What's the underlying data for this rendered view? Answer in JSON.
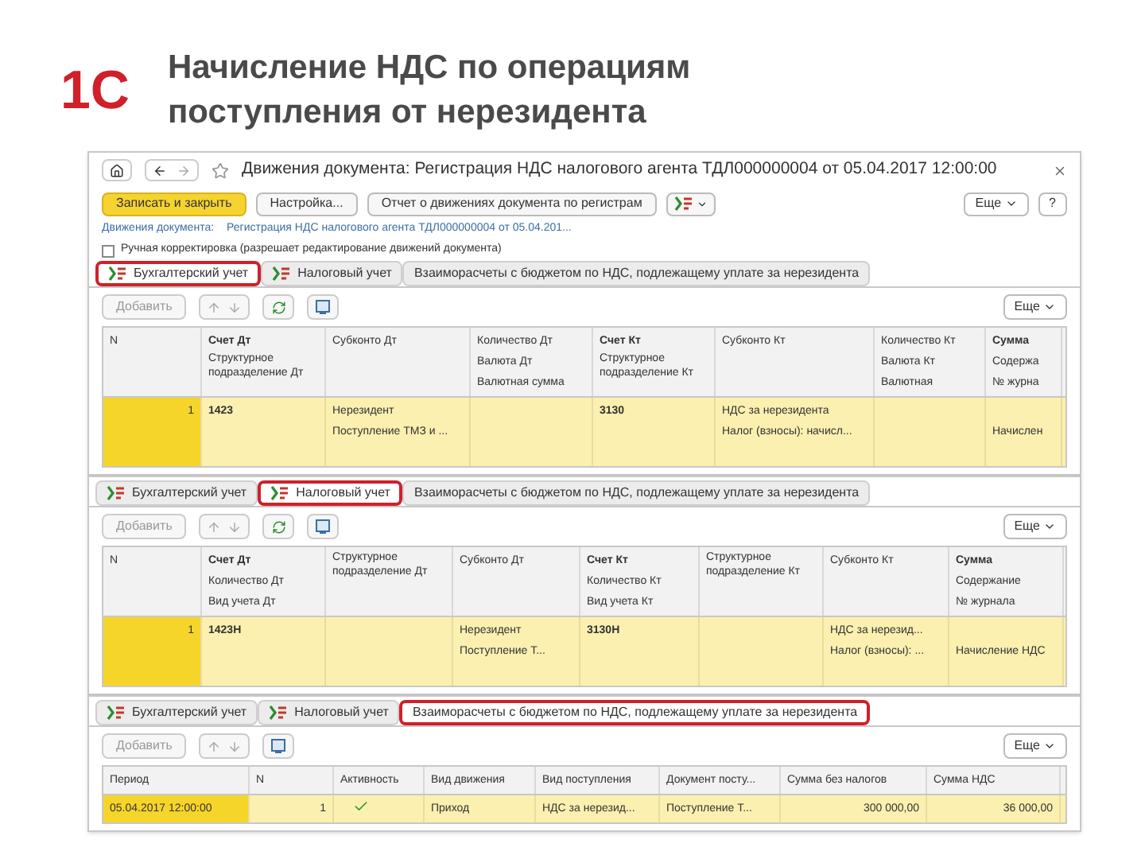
{
  "slide": {
    "logo": "1С",
    "title": "Начисление НДС по операциям поступления от нерезидента"
  },
  "main_window": {
    "title": "Движения документа: Регистрация НДС налогового агента ТДЛ000000004 от 05.04.2017 12:00:00",
    "buttons": [
      {
        "kind": "primary",
        "label": "Записать и закрыть"
      },
      {
        "kind": "plain",
        "label": "Настройка..."
      },
      {
        "kind": "plain",
        "label": "Отчет о движениях документа по регистрам"
      },
      {
        "kind": "dtkt_menu"
      }
    ],
    "more_button": "Еще",
    "help_button": "?",
    "document_label": "Движения документа:",
    "document_link": "Регистрация НДС налогового агента ТДЛ000000004 от 05.04.201...",
    "manual_edit": {
      "label": "Ручная корректировка (разрешает редактирование движений документа)",
      "checked": false
    }
  },
  "panels": [
    {
      "tabs": [
        {
          "label": "Бухгалтерский учет",
          "kind": "register",
          "selected": true
        },
        {
          "label": "Налоговый учет",
          "kind": "register",
          "selected": false
        },
        {
          "label": "Взаиморасчеты с бюджетом по НДС, подлежащему уплате за нерезидента",
          "kind": "plain",
          "selected": false
        }
      ],
      "toolbar": {
        "add_button": "Добавить",
        "more_button": "Еще",
        "tools": [
          {
            "kind": "move"
          },
          {
            "kind": "refresh"
          },
          {
            "kind": "register"
          }
        ]
      },
      "table": {
        "columns": [
          {
            "kind": "number",
            "lines": [
              "N"
            ]
          },
          {
            "kind": "account",
            "lines": [
              "Счет Дт",
              "Структурное подразделение Дт"
            ]
          },
          {
            "kind": "plain",
            "lines": [
              "Субконто Дт"
            ]
          },
          {
            "kind": "plain",
            "lines": [
              "Количество Дт",
              "Валюта Дт",
              "Валютная сумма"
            ]
          },
          {
            "kind": "account",
            "lines": [
              "Счет Кт",
              "Структурное подразделение Кт"
            ]
          },
          {
            "kind": "plain",
            "lines": [
              "Субконто Кт"
            ]
          },
          {
            "kind": "plain",
            "lines": [
              "Количество Кт",
              "Валюта Кт",
              "Валютная"
            ]
          },
          {
            "kind": "account",
            "lines": [
              "Сумма",
              "Содержа",
              "№ журна"
            ]
          }
        ],
        "rows": [
          {
            "selected": true,
            "cells": [
              [
                "1"
              ],
              [
                "1423"
              ],
              [
                "Нерезидент",
                "Поступление ТМЗ и ..."
              ],
              [],
              [
                "3130"
              ],
              [
                "НДС за нерезидента",
                "Налог (взносы): начисл..."
              ],
              [],
              [
                null,
                "Начислен"
              ]
            ]
          }
        ]
      }
    },
    {
      "tabs": [
        {
          "label": "Бухгалтерский учет",
          "kind": "register",
          "selected": false
        },
        {
          "label": "Налоговый учет",
          "kind": "register",
          "selected": true
        },
        {
          "label": "Взаиморасчеты с бюджетом по НДС, подлежащему уплате за нерезидента",
          "kind": "plain",
          "selected": false
        }
      ],
      "toolbar": {
        "add_button": "Добавить",
        "more_button": "Еще",
        "tools": [
          {
            "kind": "move"
          },
          {
            "kind": "refresh"
          },
          {
            "kind": "register"
          }
        ]
      },
      "table": {
        "columns": [
          {
            "kind": "number",
            "lines": [
              "N"
            ]
          },
          {
            "kind": "account",
            "lines": [
              "Счет Дт",
              "Количество Дт",
              "Вид учета Дт"
            ]
          },
          {
            "kind": "plain",
            "lines": [
              "Структурное подразделение Дт"
            ]
          },
          {
            "kind": "plain",
            "lines": [
              "Субконто Дт"
            ]
          },
          {
            "kind": "account",
            "lines": [
              "Счет Кт",
              "Количество Кт",
              "Вид учета Кт"
            ]
          },
          {
            "kind": "plain",
            "lines": [
              "Структурное подразделение Кт"
            ]
          },
          {
            "kind": "plain",
            "lines": [
              "Субконто Кт"
            ]
          },
          {
            "kind": "account",
            "lines": [
              "Сумма",
              "Содержание",
              "№ журнала"
            ]
          }
        ],
        "rows": [
          {
            "selected": true,
            "cells": [
              [
                "1"
              ],
              [
                "1423Н"
              ],
              [],
              [
                "Нерезидент",
                "Поступление Т..."
              ],
              [
                "3130Н"
              ],
              [],
              [
                "НДС за нерезид...",
                "Налог (взносы): ..."
              ],
              [
                null,
                "Начисление НДС"
              ]
            ]
          }
        ]
      }
    },
    {
      "tabs": [
        {
          "label": "Бухгалтерский учет",
          "kind": "register",
          "selected": false
        },
        {
          "label": "Налоговый учет",
          "kind": "register",
          "selected": false
        },
        {
          "label": "Взаиморасчеты с бюджетом по НДС, подлежащему уплате за нерезидента",
          "kind": "plain",
          "selected": true
        }
      ],
      "toolbar": {
        "add_button": "Добавить",
        "more_button": "Еще",
        "tools": [
          {
            "kind": "move"
          },
          {
            "kind": "register"
          }
        ]
      },
      "table": {
        "columns": [
          {
            "kind": "plain",
            "lines": [
              "Период"
            ]
          },
          {
            "kind": "number",
            "lines": [
              "N"
            ]
          },
          {
            "kind": "check",
            "lines": [
              "Активность"
            ]
          },
          {
            "kind": "plain",
            "lines": [
              "Вид движения"
            ]
          },
          {
            "kind": "plain",
            "lines": [
              "Вид поступления"
            ]
          },
          {
            "kind": "plain",
            "lines": [
              "Документ посту..."
            ]
          },
          {
            "kind": "number",
            "lines": [
              "Сумма без налогов"
            ]
          },
          {
            "kind": "number",
            "lines": [
              "Сумма НДС"
            ]
          }
        ],
        "rows": [
          {
            "selected": true,
            "cells": [
              [
                "05.04.2017 12:00:00"
              ],
              [
                "1"
              ],
              {
                "checked": true
              },
              [
                "Приход"
              ],
              [
                "НДС за нерезид..."
              ],
              [
                "Поступление Т..."
              ],
              [
                "300 000,00"
              ],
              [
                "36 000,00"
              ]
            ]
          }
        ]
      }
    }
  ]
}
